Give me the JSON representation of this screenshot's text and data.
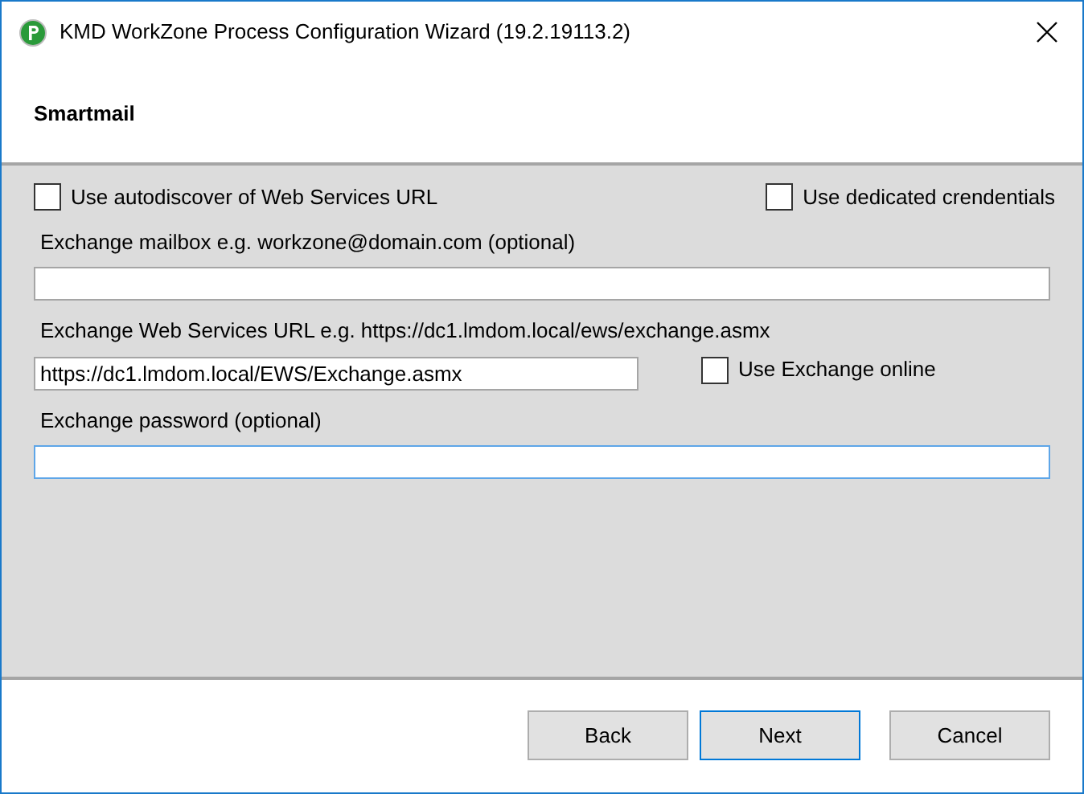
{
  "window": {
    "title": "KMD WorkZone Process Configuration Wizard (19.2.19113.2)"
  },
  "page": {
    "title": "Smartmail"
  },
  "options": [
    {
      "label": "Use autodiscover of Web Services URL",
      "checked": false
    },
    {
      "label": "Use dedicated crendentials",
      "checked": false
    }
  ],
  "mailbox": {
    "label": "Exchange mailbox e.g. workzone@domain.com (optional)",
    "focused": false
  },
  "ews_url": {
    "label": "Exchange Web Services URL e.g. https://dc1.lmdom.local/ews/exchange.asmx",
    "value": "https://dc1.lmdom.local/EWS/Exchange.asmx",
    "focused": false
  },
  "exchange_online": {
    "label": "Use Exchange online",
    "checked": false
  },
  "password": {
    "label": "Exchange password (optional)",
    "focused": true
  },
  "buttons": [
    {
      "label": "Back",
      "default": false
    },
    {
      "label": "Next",
      "default": true
    },
    {
      "label": "Cancel",
      "default": false
    }
  ]
}
